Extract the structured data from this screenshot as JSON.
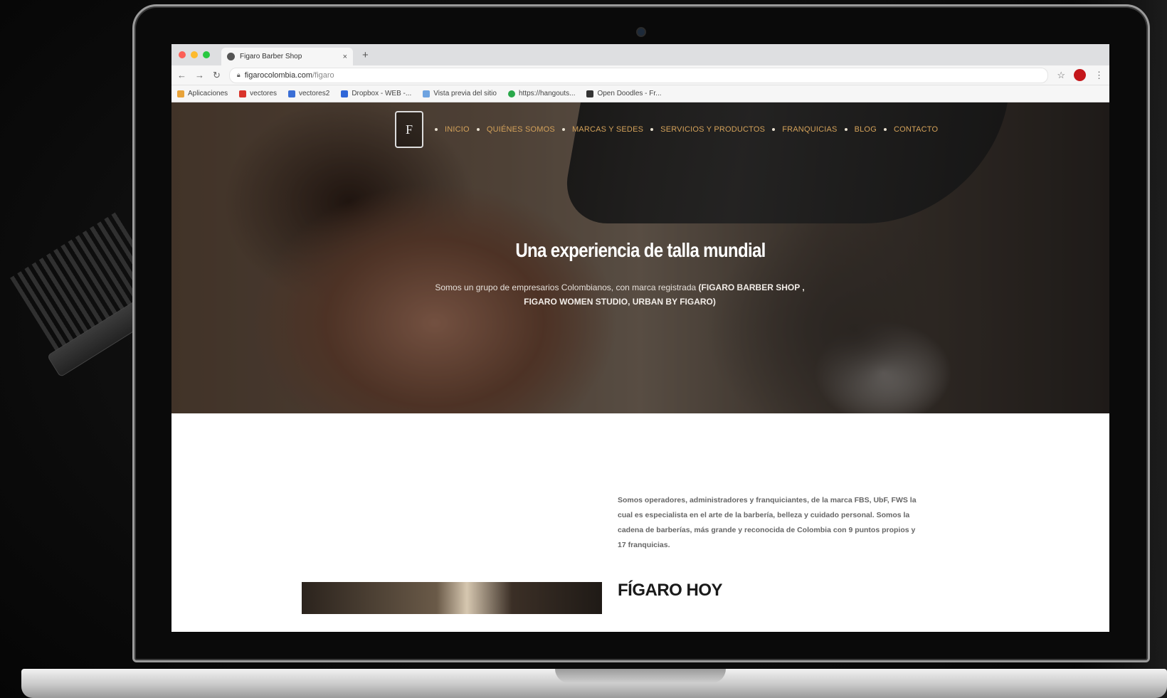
{
  "browser": {
    "tab_title": "Figaro Barber Shop",
    "tab_close": "×",
    "new_tab": "+",
    "url_domain": "figarocolombia.com",
    "url_path": "/figaro",
    "bookmarks": [
      {
        "label": "Aplicaciones",
        "color": "#e8a33a"
      },
      {
        "label": "vectores",
        "color": "#d9342b"
      },
      {
        "label": "vectores2",
        "color": "#3b6fd6"
      },
      {
        "label": "Dropbox - WEB -...",
        "color": "#2f66d8"
      },
      {
        "label": "Vista previa del sitio",
        "color": "#6ea3e0"
      },
      {
        "label": "https://hangouts...",
        "color": "#2aa84a"
      },
      {
        "label": "Open Doodles - Fr...",
        "color": "#333333"
      }
    ]
  },
  "site": {
    "logo": "F",
    "nav": [
      "Inicio",
      "Quiénes Somos",
      "Marcas y sedes",
      "Servicios y productos",
      "Franquicias",
      "Blog",
      "Contacto"
    ],
    "hero_title": "Una experiencia de talla mundial",
    "hero_sub_plain": "Somos un grupo de empresarios Colombianos, con marca registrada ",
    "hero_sub_bold": "(FIGARO BARBER SHOP , FIGARO WOMEN STUDIO, URBAN BY FIGARO)",
    "about_text": "Somos operadores, administradores y franquiciantes, de la marca FBS, UbF, FWS la cual es especialista en el arte de la barbería, belleza y cuidado personal. Somos la cadena de barberías, más grande y reconocida de Colombia con 9 puntos propios y 17 franquicias.",
    "section_title": "FÍGARO HOY"
  },
  "colors": {
    "nav_accent": "#d4a25a",
    "profile": "#c4171b"
  }
}
